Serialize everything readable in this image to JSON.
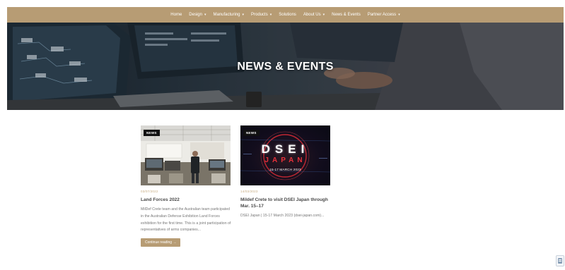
{
  "nav": {
    "items": [
      {
        "label": "Home",
        "caret": false
      },
      {
        "label": "Design",
        "caret": true
      },
      {
        "label": "Manufacturing",
        "caret": true
      },
      {
        "label": "Products",
        "caret": true
      },
      {
        "label": "Solutions",
        "caret": false
      },
      {
        "label": "About Us",
        "caret": true
      },
      {
        "label": "News & Events",
        "caret": false
      },
      {
        "label": "Partner Access",
        "caret": true
      }
    ],
    "bar_color": "#b79c74"
  },
  "hero": {
    "title": "NEWS & EVENTS"
  },
  "posts": [
    {
      "badge": "NEWS",
      "date": "03/07/2022",
      "title": "Land Forces 2022",
      "excerpt": "MilDef Crete team and the Australian team participated in the Australian Defense Exhibition Land Forces exhibition for the first time. This is a joint participation of representatives of arms companies...",
      "read_more": "Continue reading →"
    },
    {
      "badge": "NEWS",
      "date": "14/03/2023",
      "title": "Mildef Crete to visit DSEI Japan through Mar. 15–17",
      "excerpt": "DSEI Japan | 15-17 March 2023 (dsei-japan.com)...",
      "image_text": {
        "main": "DSEI",
        "sub": "JAPAN",
        "dates": "15-17 MARCH 2023"
      }
    }
  ],
  "colors": {
    "accent": "#b79c74",
    "date": "#c8ad83",
    "dsei_red": "#e8303a"
  }
}
